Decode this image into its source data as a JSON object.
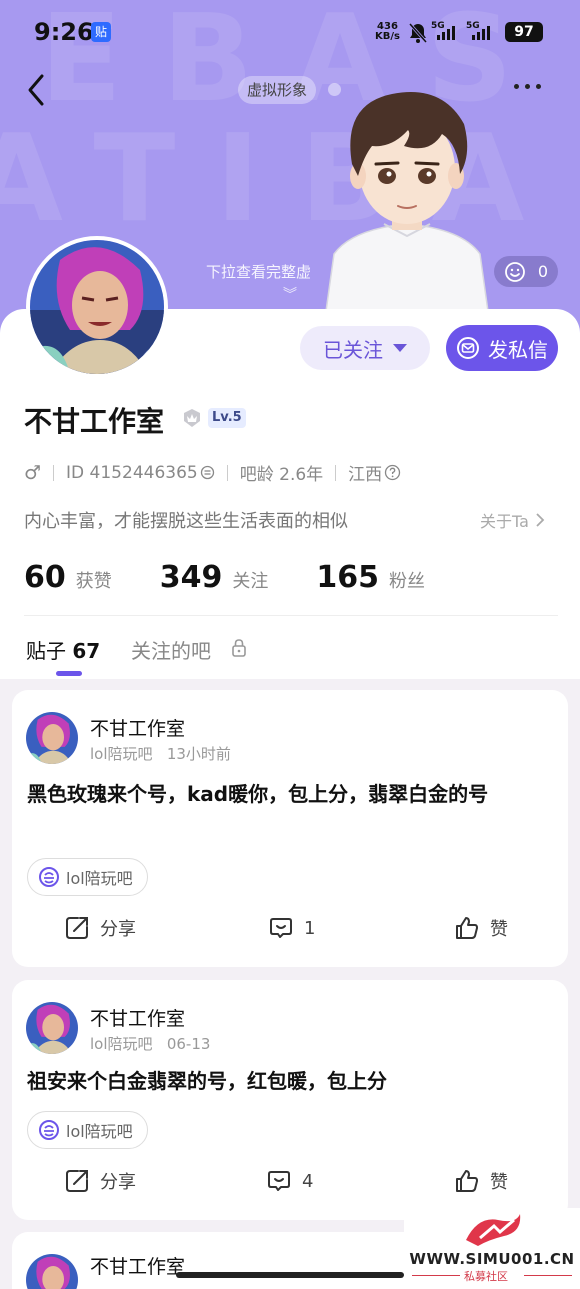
{
  "status_bar": {
    "time": "9:26",
    "app_badge": "贴",
    "net_speed_value": "436",
    "net_speed_unit": "KB/s",
    "sim1": "5G",
    "sim2": "5G",
    "battery": "97"
  },
  "header": {
    "virtual_label": "虚拟形象",
    "pulldown_hint": "下拉查看完整虚",
    "like_count": "0"
  },
  "profile": {
    "follow_label": "已关注",
    "message_label": "发私信",
    "name": "不甘工作室",
    "level": "Lv.5",
    "gender_symbol": "♂",
    "id_text": "ID 4152446365",
    "age_text": "吧龄 2.6年",
    "location": "江西",
    "bio": "内心丰富，才能摆脱这些生活表面的相似",
    "about_label": "关于Ta"
  },
  "stats": [
    {
      "value": "60",
      "label": "获赞"
    },
    {
      "value": "349",
      "label": "关注"
    },
    {
      "value": "165",
      "label": "粉丝"
    }
  ],
  "tabs": {
    "posts_label": "贴子",
    "posts_count": "67",
    "followed_bars_label": "关注的吧"
  },
  "posts": [
    {
      "author": "不甘工作室",
      "forum": "lol陪玩吧",
      "time": "13小时前",
      "text": "黑色玫瑰来个号，kad暖你，包上分，翡翠白金的号",
      "tag": "lol陪玩吧",
      "share_label": "分享",
      "comments": "1",
      "like_label": "赞"
    },
    {
      "author": "不甘工作室",
      "forum": "lol陪玩吧",
      "time": "06-13",
      "text": "祖安来个白金翡翠的号，红包暖，包上分",
      "tag": "lol陪玩吧",
      "share_label": "分享",
      "comments": "4",
      "like_label": "赞"
    },
    {
      "author": "不甘工作室"
    }
  ],
  "watermark": {
    "url": "WWW.SIMU001.CN",
    "name": "私募社区"
  },
  "colors": {
    "hero_bg": "#a799f0",
    "accent": "#6c55ea"
  }
}
